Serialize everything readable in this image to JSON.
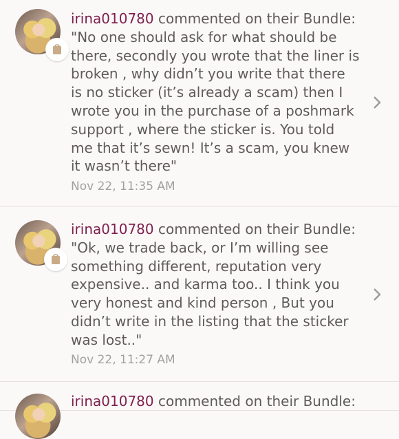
{
  "notifications": [
    {
      "username": "irina010780",
      "action": " commented on their Bundle:",
      "comment": "\"No one should ask for what should be there, secondly you wrote that the liner is broken , why didn’t you write that there is no sticker (it’s already a scam) then I wrote you in the purchase of a poshmark support , where the sticker is. You told me that it’s sewn! It’s a scam, you knew it wasn’t there\"",
      "timestamp": "Nov 22, 11:35 AM",
      "icons": {
        "avatar": "user-avatar",
        "badge": "shopping-bag-icon",
        "chevron": "chevron-right-icon"
      }
    },
    {
      "username": "irina010780",
      "action": " commented on their Bundle:",
      "comment": "\"Ok, we trade back, or I’m willing see something different, reputation very expensive.. and karma too.. I think you very honest and kind person , But you didn’t write in the listing that the sticker was lost..\"",
      "timestamp": "Nov 22, 11:27 AM",
      "icons": {
        "avatar": "user-avatar",
        "badge": "shopping-bag-icon",
        "chevron": "chevron-right-icon"
      }
    },
    {
      "username": "irina010780",
      "action": " commented on their Bundle:"
    }
  ],
  "colors": {
    "username": "#7f1f4d",
    "text": "#5f5b5b",
    "timestamp": "#a29f9f",
    "background": "#fbf9f8",
    "divider": "#e6e2e2"
  }
}
